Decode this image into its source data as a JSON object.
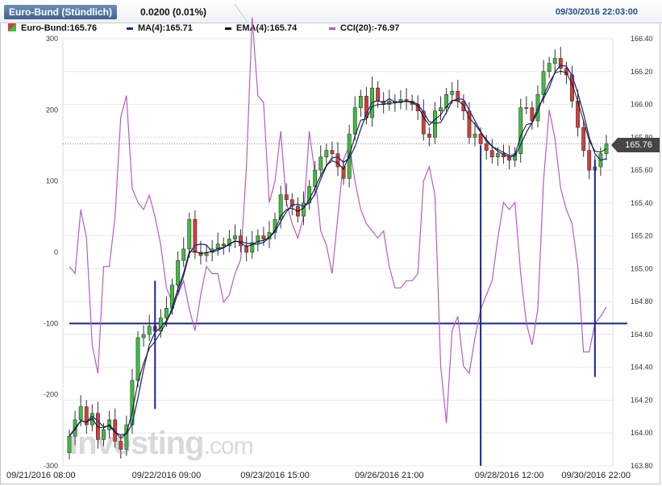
{
  "header": {
    "title": "Euro-Bund (Stündlich)",
    "change": "0.0200 (0.01%)",
    "datetime": "09/30/2016 22:03:00"
  },
  "legend": {
    "price": "Euro-Bund:165.76",
    "ma": "MA(4):165.71",
    "ema": "EMA(4):165.74",
    "cci": "CCI(20):-76.97"
  },
  "price_tag": "165.76",
  "watermark": {
    "main": "investing",
    "suffix": ".com"
  },
  "colors": {
    "up": "#3dbf3d",
    "down": "#d93a3a",
    "ma": "#1f2a8c",
    "ema": "#111111",
    "cci": "#b65cc6",
    "hline": "#1a2299",
    "vline": "#1a2299"
  },
  "chart_data": {
    "type": "line",
    "x_ticks": [
      "09/21/2016 08:00",
      "09/22/2016 09:00",
      "09/23/2016 15:00",
      "09/26/2016 21:00",
      "09/28/2016 12:00",
      "09/30/2016 22:00"
    ],
    "price_axis": {
      "ticks": [
        "166.40",
        "166.20",
        "166.00",
        "165.80",
        "165.60",
        "165.40",
        "165.20",
        "165.00",
        "164.80",
        "164.60",
        "164.40",
        "164.20",
        "164.00",
        "163.80"
      ],
      "ylim": [
        163.8,
        166.4
      ]
    },
    "cci_axis": {
      "ticks": [
        "300",
        "200",
        "100",
        "0",
        "-100",
        "-200",
        "-300"
      ],
      "ylim": [
        -300,
        300
      ]
    },
    "last_price": 165.76,
    "cci_reference_line": -100,
    "close": [
      163.98,
      164.08,
      164.16,
      164.05,
      164.12,
      163.96,
      164.02,
      164.08,
      163.95,
      163.9,
      164.05,
      164.32,
      164.58,
      164.6,
      164.65,
      164.62,
      164.7,
      164.76,
      164.9,
      165.05,
      165.12,
      165.3,
      165.1,
      165.08,
      165.1,
      165.12,
      165.15,
      165.14,
      165.18,
      165.2,
      165.14,
      165.1,
      165.16,
      165.2,
      165.18,
      165.22,
      165.3,
      165.45,
      165.42,
      165.38,
      165.32,
      165.4,
      165.5,
      165.6,
      165.68,
      165.72,
      165.7,
      165.62,
      165.55,
      165.82,
      165.98,
      166.05,
      165.92,
      166.1,
      166.02,
      166.0,
      166.02,
      166.01,
      166.03,
      166.02,
      166.0,
      165.96,
      165.82,
      165.8,
      165.96,
      165.98,
      166.06,
      166.08,
      166.02,
      165.96,
      165.8,
      165.82,
      165.76,
      165.72,
      165.68,
      165.7,
      165.68,
      165.66,
      165.7,
      165.98,
      165.98,
      165.9,
      166.06,
      166.2,
      166.25,
      166.28,
      166.22,
      166.18,
      166.02,
      165.86,
      165.72,
      165.6,
      165.62,
      165.7,
      165.76
    ],
    "cci": [
      -20,
      -30,
      60,
      20,
      -130,
      -170,
      -20,
      -20,
      50,
      190,
      220,
      90,
      70,
      60,
      80,
      50,
      10,
      -50,
      -70,
      -60,
      -40,
      -80,
      -110,
      -60,
      -20,
      -30,
      -30,
      -70,
      -60,
      -30,
      -10,
      120,
      330,
      220,
      210,
      70,
      100,
      170,
      70,
      40,
      20,
      50,
      170,
      110,
      30,
      10,
      -30,
      50,
      130,
      150,
      100,
      60,
      40,
      30,
      20,
      30,
      -20,
      -50,
      -50,
      -40,
      -40,
      -30,
      100,
      120,
      80,
      -160,
      -240,
      -110,
      -90,
      -160,
      -170,
      -120,
      -80,
      -60,
      -40,
      20,
      70,
      60,
      70,
      -30,
      -100,
      -130,
      -80,
      100,
      200,
      160,
      90,
      60,
      40,
      -20,
      -140,
      -140,
      -100,
      -90,
      -77
    ],
    "blue_vertical_markers": [
      {
        "x_index": 15,
        "cci_from": -40,
        "cci_to": -220
      },
      {
        "x_index": 72,
        "cci_from": 150,
        "cci_to": -300
      },
      {
        "x_index": 92,
        "cci_from": 130,
        "cci_to": -175
      }
    ]
  }
}
